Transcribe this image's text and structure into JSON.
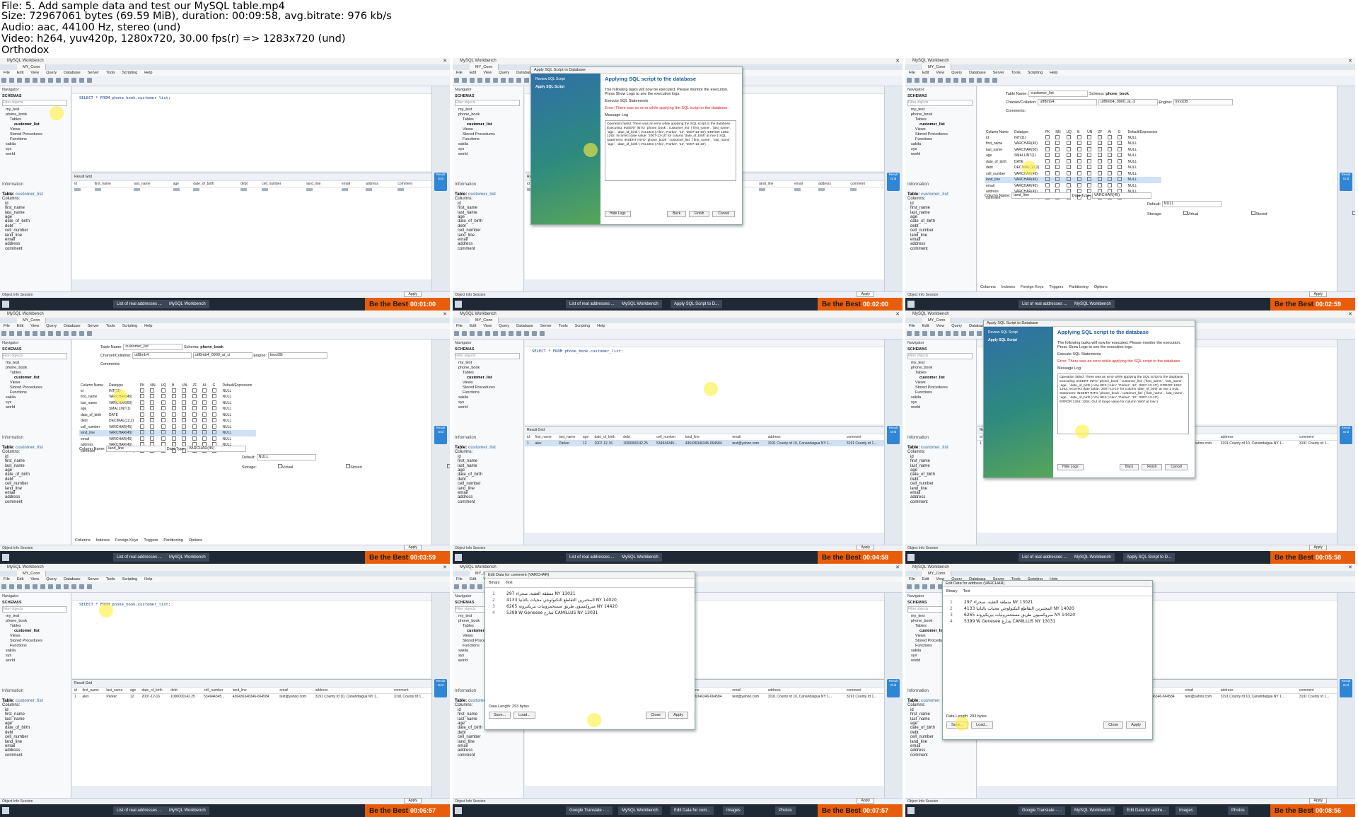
{
  "header": {
    "file": "File: 5. Add sample data and test our MySQL table.mp4",
    "size": "Size: 72967061 bytes (69.59 MiB), duration: 00:09:58, avg.bitrate: 976 kb/s",
    "audio": "Audio: aac, 44100 Hz, stereo (und)",
    "video": "Video: h264, yuv420p, 1280x720, 30.00 fps(r) => 1283x720 (und)",
    "author": "Orthodox"
  },
  "app": {
    "title": "MySQL Workbench",
    "connection_tab": "MY_Conn",
    "menu": [
      "File",
      "Edit",
      "View",
      "Query",
      "Database",
      "Server",
      "Tools",
      "Scripting",
      "Help"
    ],
    "navigator": "Navigator",
    "schemas": "SCHEMAS",
    "filter_placeholder": "Filter objects",
    "tree": [
      "my_test",
      "phone_book",
      "Tables",
      "customer_list",
      "Views",
      "Stored Procedures",
      "Functions",
      "sakila",
      "sys",
      "world"
    ],
    "information": "Information",
    "table_label": "Table:",
    "table_name": "customer_list",
    "columns_label": "Columns:",
    "columns": [
      "id",
      "first_name",
      "last_name",
      "age",
      "date_of_birth",
      "debt",
      "cell_number",
      "land_line",
      "email",
      "address",
      "comment"
    ],
    "sql": "SELECT * FROM phone_book.customer_list;",
    "result_grid": "Result Grid",
    "grid_headers": [
      "id",
      "first_name",
      "last_name",
      "age",
      "date_of_birth",
      "debt",
      "cell_number",
      "land_line",
      "email",
      "address",
      "comment"
    ],
    "row": [
      "1",
      "alex",
      "Parker",
      "12",
      "2007-12-16",
      "1000000142.25",
      "534944345...",
      "436436346346-664584",
      "test@yahoo.com",
      "3191 County rd 10, Canandaigua NY 1...",
      "3191 County rd 1..."
    ],
    "object_info": "Object Info",
    "session": "Session",
    "apply": "Apply",
    "revert": "Revert",
    "result_side": "Result Grid"
  },
  "apply_dialog": {
    "title": "Apply SQL Script to Database",
    "steps": [
      "Review SQL Script",
      "Apply SQL Script"
    ],
    "heading": "Applying SQL script to the database",
    "desc": "The following tasks will now be executed. Please monitor the execution. Press Show Logs to see the execution logs.",
    "task": "Execute SQL Statements",
    "error": "Error: There was an error while applying the SQL script to the database.",
    "message_log": "Message Log",
    "log": "Operation failed: There was an error while applying the SQL script to the database. Executing: INSERT INTO `phone_book`.`customer_list` (`first_name`, `last_name`, `age`, `date_of_birth`) VALUES ('Alex', 'Parker', '12', '2007-13-10'); ERROR 1292: 1292: Incorrect date value: '2007-13-10' for column 'date_of_birth' at row 1 SQL Statement: INSERT INTO `phone_book`.`customer_list` (`first_name`, `last_name`, `age`, `date_of_birth`) VALUES ('Alex', 'Parker', '12', '2007-13-10')",
    "log2": "ERROR 1264: 1264: Out of range value for column 'debt' at row 1",
    "hide_logs": "Hide Logs",
    "back": "Back",
    "finish": "Finish",
    "cancel": "Cancel"
  },
  "table_editor": {
    "table_name_label": "Table Name:",
    "table_name": "customer_list",
    "schema_label": "Schema:",
    "schema": "phone_book",
    "charset_label": "Charset/Collation:",
    "charset": "utf8mb4",
    "collation": "utf8mb4_0900_ai_ci",
    "engine_label": "Engine:",
    "engine": "InnoDB",
    "comments_label": "Comments:",
    "col_headers": [
      "Column Name",
      "Datatype",
      "PK",
      "NN",
      "UQ",
      "B",
      "UN",
      "ZF",
      "AI",
      "G",
      "Default/Expression"
    ],
    "rows": [
      [
        "id",
        "INT(11)",
        "NULL"
      ],
      [
        "first_name",
        "VARCHAR(45)",
        "NULL"
      ],
      [
        "last_name",
        "VARCHAR(60)",
        "NULL"
      ],
      [
        "age",
        "SMALLINT(1)",
        "NULL"
      ],
      [
        "date_of_birth",
        "DATE",
        "NULL"
      ],
      [
        "debt",
        "DECIMAL(12,2)",
        "NULL"
      ],
      [
        "cell_number",
        "VARCHAR(45)",
        "NULL"
      ],
      [
        "land_line",
        "VARCHAR(45)",
        "NULL"
      ],
      [
        "email",
        "VARCHAR(45)",
        "NULL"
      ],
      [
        "address",
        "VARCHAR(45)",
        "NULL"
      ],
      [
        "comment",
        "VARCHAR(500)",
        "NULL"
      ]
    ],
    "column_name_label": "Column Name:",
    "column_name": "land_line",
    "data_type_label": "Data Type:",
    "data_type": "VARCHAR(45)",
    "default_label": "Default:",
    "default": "NULL",
    "storage_label": "Storage:",
    "storage_opts": [
      "Virtual",
      "Stored",
      "Primary Key",
      "Not Null",
      "Unique",
      "Binary",
      "Unsigned",
      "Zero Fill",
      "Auto Increment",
      "Generated"
    ],
    "bottom_tabs": [
      "Columns",
      "Indexes",
      "Foreign Keys",
      "Triggers",
      "Partitioning",
      "Options"
    ]
  },
  "edit_dialog": {
    "title_comment": "Edit Data for comment (VARCHAR)",
    "title_address": "Edit Data for address (VARCHAR)",
    "tabs": [
      "Binary",
      "Text"
    ],
    "lines": [
      "297 منطقة العقبة، صحراء NY 13021",
      "4133 المختبرين التقاطع التكنولوجي محيات بالنانيا NY 14020",
      "6265 مبروكسيون طريق مستحمرونيات بيريكيرونة NY 14420",
      "5399 W Genesee شارع CAMILLUS NY 13031"
    ],
    "data_length": "Data Length: 293 bytes",
    "save": "Save...",
    "load": "Load...",
    "close": "Close",
    "apply": "Apply"
  },
  "taskbar": {
    "tasks": [
      "List of real addresses ...",
      "MySQL Workbench",
      "Apply SQL Script to D...",
      "Google Translate - ...",
      "Edit Data for com...",
      "Images",
      "Photos",
      "Edit Data for addre..."
    ],
    "brand": "Be the Best",
    "timestamps": [
      "00:01:00",
      "00:02:00",
      "00:02:59",
      "00:03:59",
      "00:04:58",
      "00:05:58",
      "00:06:57",
      "00:07:57",
      "00:08:56"
    ]
  }
}
